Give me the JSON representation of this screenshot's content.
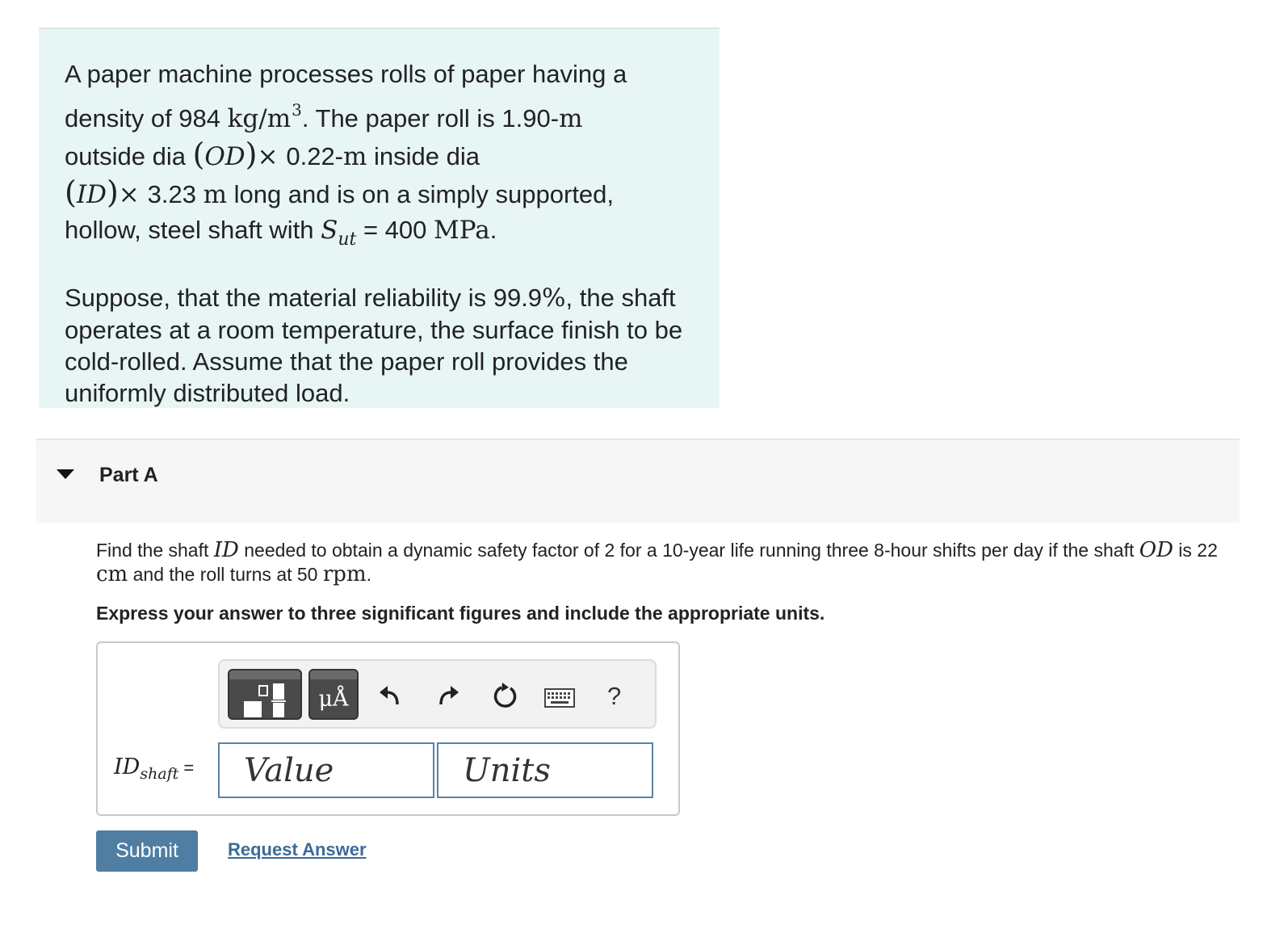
{
  "intro": {
    "line1": "A paper machine processes rolls of paper having a",
    "line2_pre": "density of 984 ",
    "line2_unit": "kg/m",
    "line2_exp": "3",
    "line2_post": ". The paper roll is 1.90-",
    "line2_m": "m",
    "line3_pre": "outside dia ",
    "od": "OD",
    "line3_times": "× ",
    "line3_val": "0.22-",
    "line3_m": "m",
    "line3_post": " inside dia",
    "id": "ID",
    "line4_times": "× ",
    "line4_val": "3.23 ",
    "line4_m": "m",
    "line4_post": " long and is on a simply supported,",
    "line5_pre": "hollow, steel shaft with ",
    "sut_s": "S",
    "sut_sub": "ut",
    "line5_eq": " = 400 ",
    "line5_unit": "MPa",
    "line5_end": ".",
    "p2_pre": "Suppose, that the material reliability is 99.9",
    "p2_pct": "%",
    "p2_post": ", the shaft operates at a room temperature, the surface finish to be cold-rolled. Assume that the paper roll provides the uniformly distributed load."
  },
  "part": {
    "title": "Part A",
    "question_pre": "Find the shaft ",
    "question_id": "ID",
    "question_mid": " needed to obtain a dynamic safety factor of 2 for a 10-year life running three 8-hour shifts per day if the shaft ",
    "question_od": "OD",
    "question_is": " is 22 ",
    "question_cm": "cm",
    "question_roll": " and the roll turns at 50 ",
    "question_rpm": "rpm",
    "question_end": ".",
    "instructions": "Express your answer to three significant figures and include the appropriate units."
  },
  "answer": {
    "var_main": "ID",
    "var_sub": "shaft",
    "var_eq": "=",
    "value_placeholder": "Value",
    "units_placeholder": "Units",
    "value": "",
    "units": ""
  },
  "toolbar": {
    "units_glyph": "μÅ",
    "help": "?",
    "icons": [
      "templates-icon",
      "units-icon",
      "undo-icon",
      "redo-icon",
      "reset-icon",
      "keyboard-icon",
      "help-icon"
    ]
  },
  "actions": {
    "submit": "Submit",
    "request_answer": "Request Answer"
  },
  "colors": {
    "intro_bg": "#e8f5f5",
    "submit_bg": "#4f7ea2",
    "link": "#3b6b98",
    "input_border": "#5a82a6"
  }
}
